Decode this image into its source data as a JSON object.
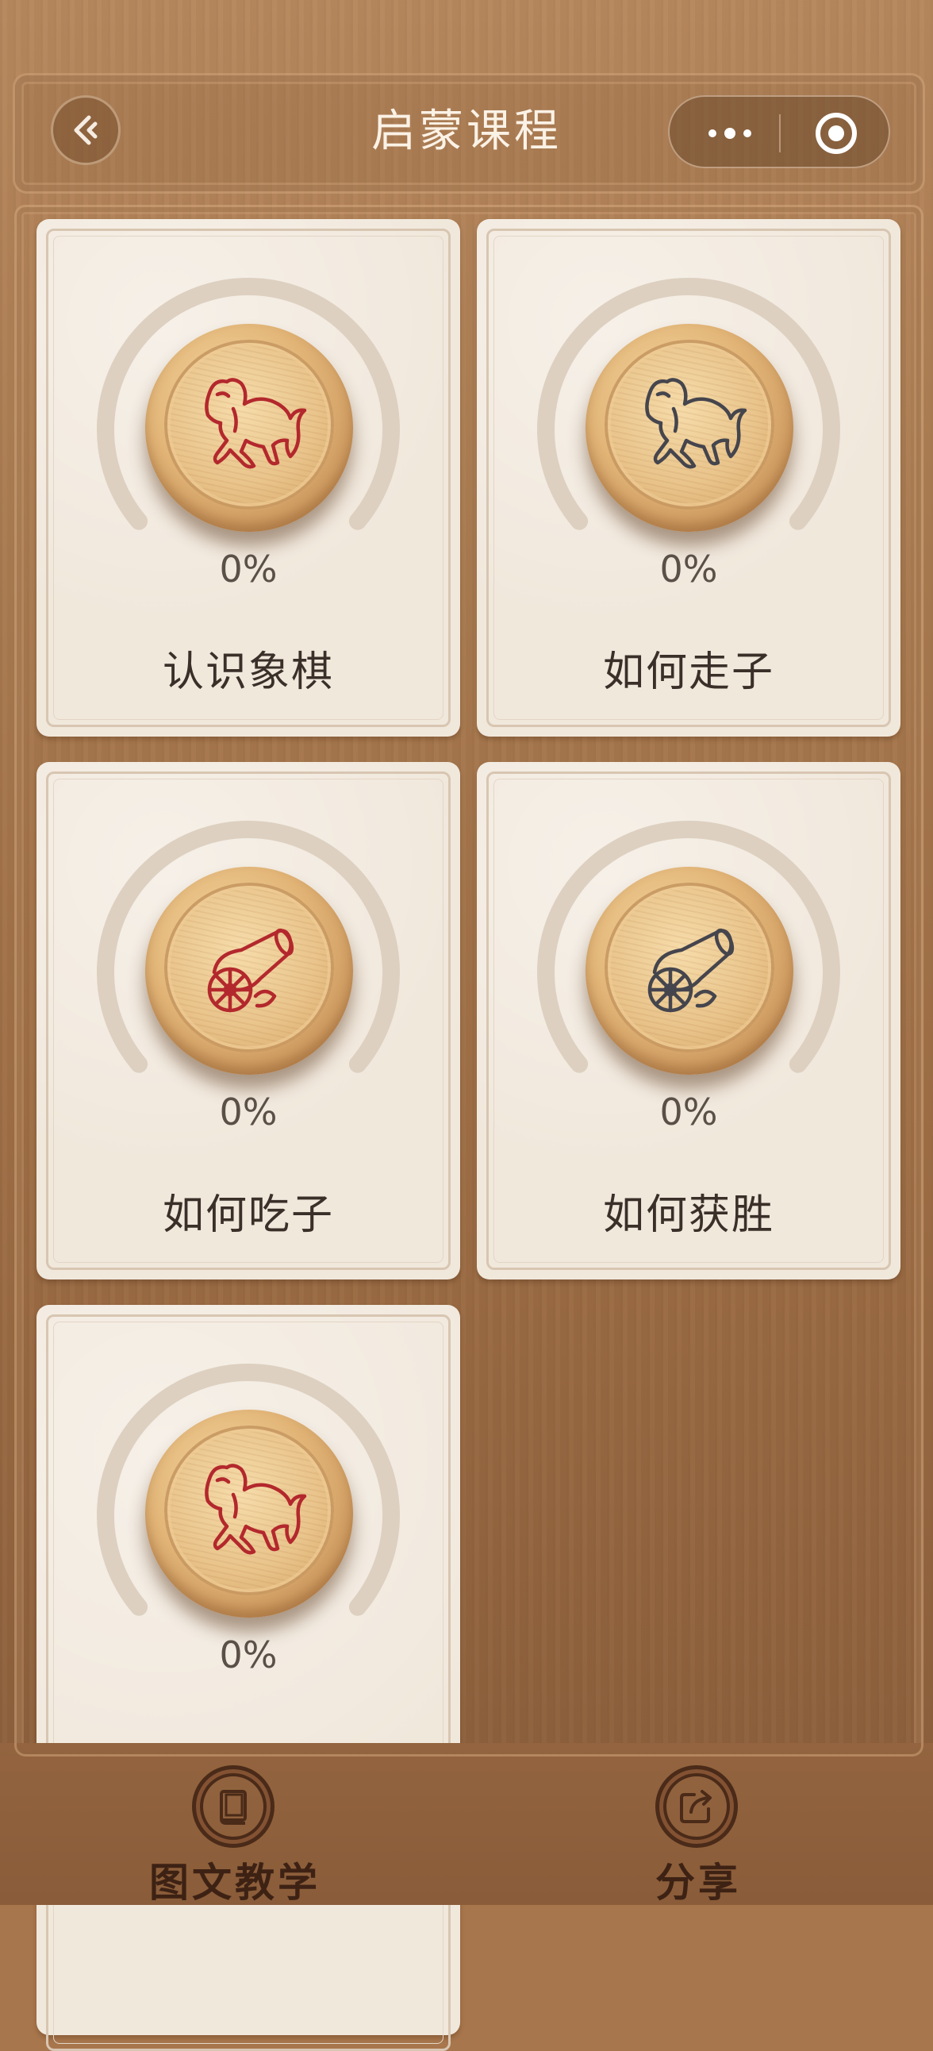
{
  "header": {
    "title": "启蒙课程",
    "back_icon": "back-arrow-icon",
    "more_icon": "more-dots-icon",
    "close_icon": "capsule-close-icon"
  },
  "courses": [
    {
      "title": "认识象棋",
      "progress_label": "0%",
      "progress": 0,
      "piece": "horse",
      "piece_color": "#b3282d"
    },
    {
      "title": "如何走子",
      "progress_label": "0%",
      "progress": 0,
      "piece": "horse",
      "piece_color": "#45454d"
    },
    {
      "title": "如何吃子",
      "progress_label": "0%",
      "progress": 0,
      "piece": "cannon",
      "piece_color": "#b3282d"
    },
    {
      "title": "如何获胜",
      "progress_label": "0%",
      "progress": 0,
      "piece": "cannon",
      "piece_color": "#45454d"
    },
    {
      "title": "",
      "progress_label": "0%",
      "progress": 0,
      "piece": "horse",
      "piece_color": "#b3282d"
    }
  ],
  "tabbar": {
    "items": [
      {
        "label": "图文教学",
        "icon": "book-icon"
      },
      {
        "label": "分享",
        "icon": "share-icon"
      }
    ]
  },
  "colors": {
    "wood": "#a8764c",
    "card": "#f1e8dc",
    "red_piece": "#b3282d",
    "black_piece": "#45454d",
    "ring": "#ddd0c0"
  }
}
